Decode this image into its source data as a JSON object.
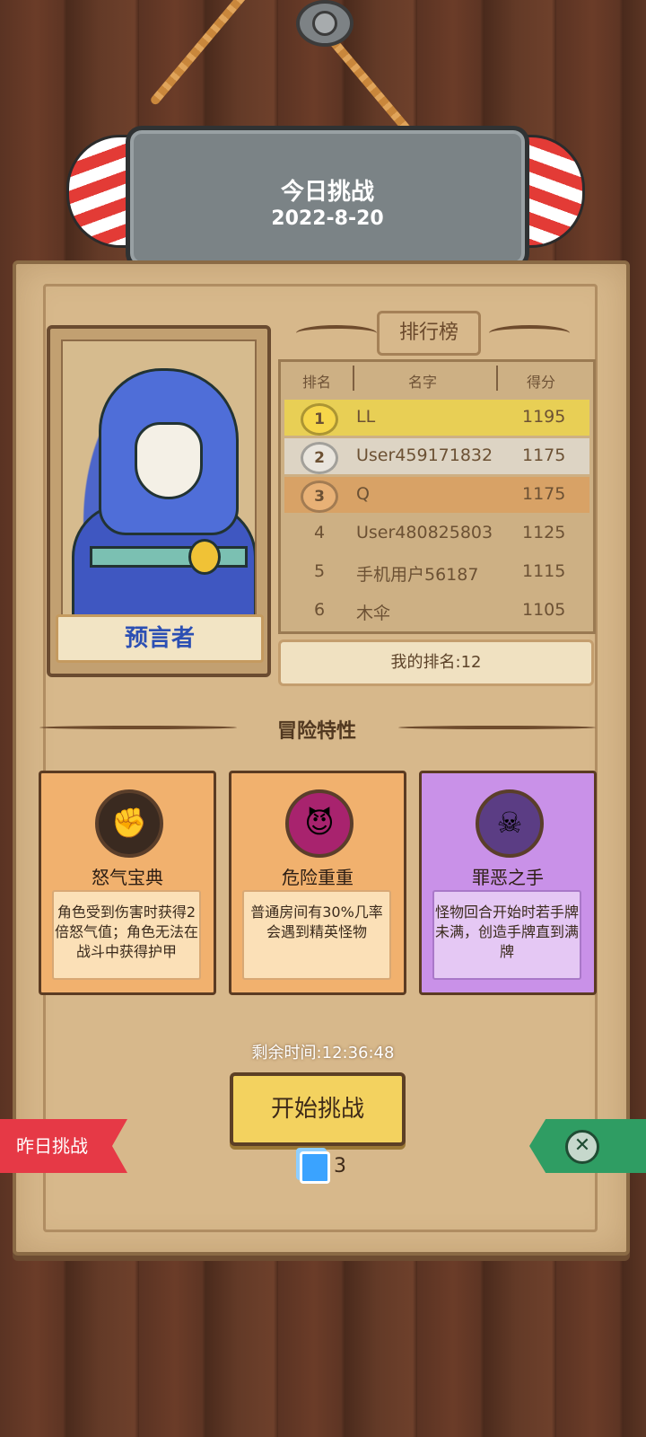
{
  "header": {
    "title": "今日挑战",
    "date": "2022-8-20"
  },
  "hero": {
    "name": "预言者",
    "portrait_icon": "wizard-portrait"
  },
  "leaderboard": {
    "title": "排行榜",
    "columns": [
      "排名",
      "名字",
      "得分"
    ],
    "rows": [
      {
        "rank": "1",
        "name": "LL",
        "score": "1195",
        "medal": "gold",
        "bg": "#e8cf55"
      },
      {
        "rank": "2",
        "name": "User459171832",
        "score": "1175",
        "medal": "silver",
        "bg": "#ddd4c4"
      },
      {
        "rank": "3",
        "name": "Q",
        "score": "1175",
        "medal": "bronze",
        "bg": "#d8a266"
      },
      {
        "rank": "4",
        "name": "User480825803",
        "score": "1125",
        "medal": "",
        "bg": "transparent"
      },
      {
        "rank": "5",
        "name": "手机用户56187",
        "score": "1115",
        "medal": "",
        "bg": "transparent"
      },
      {
        "rank": "6",
        "name": "木伞",
        "score": "1105",
        "medal": "",
        "bg": "transparent"
      }
    ],
    "my_rank": "我的排名:12"
  },
  "traits": {
    "title": "冒险特性",
    "items": [
      {
        "name": "怒气宝典",
        "desc": "角色受到伤害时获得2倍怒气值；角色无法在战斗中获得护甲",
        "icon": "fist-icon",
        "color": "orange"
      },
      {
        "name": "危险重重",
        "desc": "普通房间有30%几率会遇到精英怪物",
        "icon": "demon-face-icon",
        "color": "orange"
      },
      {
        "name": "罪恶之手",
        "desc": "怪物回合开始时若手牌未满，创造手牌直到满牌",
        "icon": "skull-hand-icon",
        "color": "purple"
      }
    ]
  },
  "footer": {
    "remaining_time": "剩余时间:12:36:48",
    "start_button": "开始挑战",
    "cards_count": "3",
    "yesterday_button": "昨日挑战",
    "close_icon": "close-icon"
  },
  "colors": {
    "accent_yellow": "#f3d25f",
    "yesterday_red": "#e63946",
    "close_green": "#2f9d63"
  }
}
